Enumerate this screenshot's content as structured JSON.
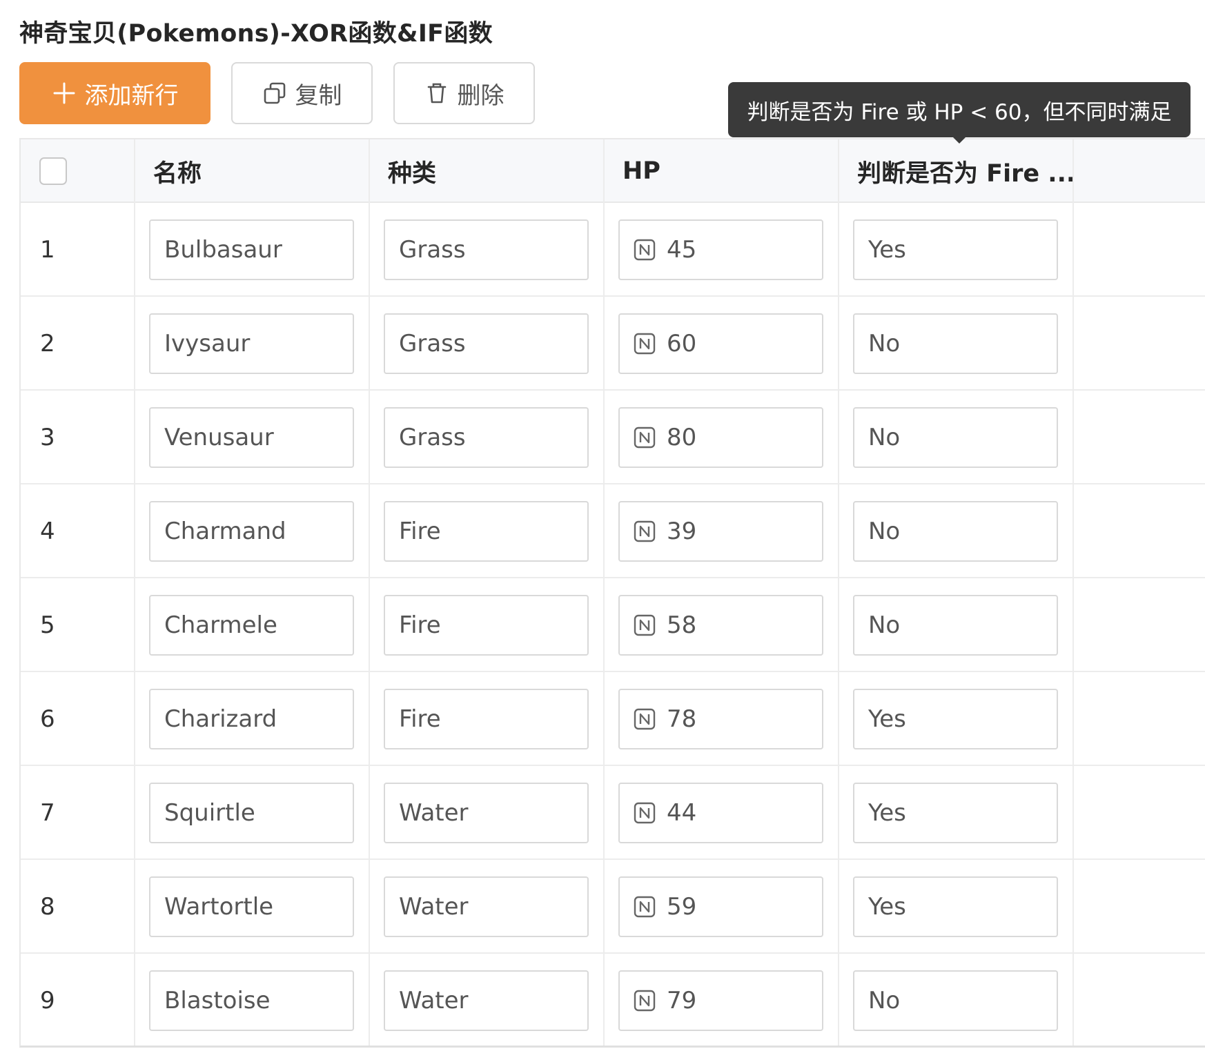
{
  "title": "神奇宝贝(Pokemons)-XOR函数&IF函数",
  "toolbar": {
    "add_label": "添加新行",
    "copy_label": "复制",
    "delete_label": "删除"
  },
  "tooltip": "判断是否为 Fire 或 HP < 60，但不同时满足",
  "columns": [
    "名称",
    "种类",
    "HP",
    "判断是否为 Fire ..."
  ],
  "rows": [
    {
      "index": "1",
      "name": "Bulbasaur",
      "type": "Grass",
      "hp": "45",
      "result": "Yes"
    },
    {
      "index": "2",
      "name": "Ivysaur",
      "type": "Grass",
      "hp": "60",
      "result": "No"
    },
    {
      "index": "3",
      "name": "Venusaur",
      "type": "Grass",
      "hp": "80",
      "result": "No"
    },
    {
      "index": "4",
      "name": "Charmand",
      "type": "Fire",
      "hp": "39",
      "result": "No"
    },
    {
      "index": "5",
      "name": "Charmele",
      "type": "Fire",
      "hp": "58",
      "result": "No"
    },
    {
      "index": "6",
      "name": "Charizard",
      "type": "Fire",
      "hp": "78",
      "result": "Yes"
    },
    {
      "index": "7",
      "name": "Squirtle",
      "type": "Water",
      "hp": "44",
      "result": "Yes"
    },
    {
      "index": "8",
      "name": "Wartortle",
      "type": "Water",
      "hp": "59",
      "result": "Yes"
    },
    {
      "index": "9",
      "name": "Blastoise",
      "type": "Water",
      "hp": "79",
      "result": "No"
    }
  ],
  "colors": {
    "accent": "#f0913e",
    "tooltip_bg": "#3a3a3a",
    "header_bg": "#f7f8fa",
    "border": "#d9d9d9"
  },
  "icons": {
    "add": "plus-icon",
    "copy": "copy-icon",
    "delete": "trash-icon",
    "number_field": "number-type-icon"
  }
}
